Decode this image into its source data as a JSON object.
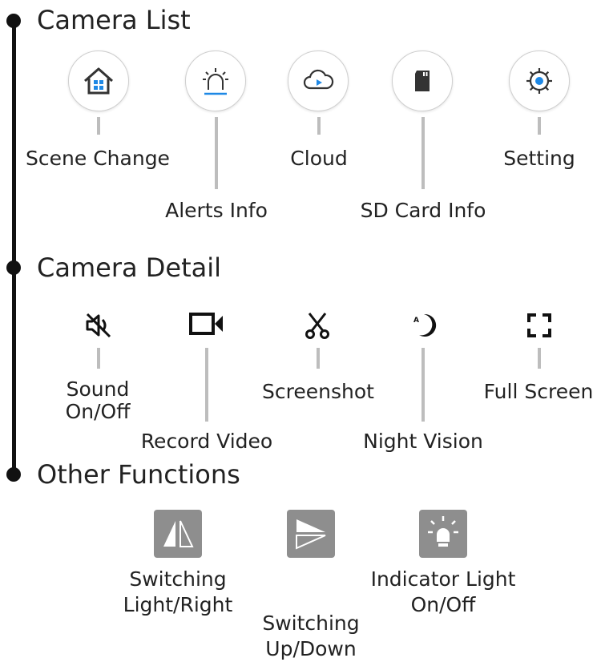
{
  "sections": {
    "camera_list": {
      "title": "Camera List",
      "items": [
        {
          "label": "Scene Change",
          "icon": "house-icon"
        },
        {
          "label": "Alerts Info",
          "icon": "alarm-icon"
        },
        {
          "label": "Cloud",
          "icon": "cloud-icon"
        },
        {
          "label": "SD Card Info",
          "icon": "sd-card-icon"
        },
        {
          "label": "Setting",
          "icon": "gear-icon"
        }
      ]
    },
    "camera_detail": {
      "title": "Camera Detail",
      "items": [
        {
          "label": "Sound\nOn/Off",
          "icon": "mute-icon"
        },
        {
          "label": "Record Video",
          "icon": "video-camera-icon"
        },
        {
          "label": "Screenshot",
          "icon": "scissors-icon"
        },
        {
          "label": "Night Vision",
          "icon": "moon-icon"
        },
        {
          "label": "Full Screen",
          "icon": "fullscreen-icon"
        }
      ]
    },
    "other_functions": {
      "title": "Other Functions",
      "items": [
        {
          "label": "Switching\nLight/Right",
          "icon": "mirror-icon"
        },
        {
          "label": "Switching\nUp/Down",
          "icon": "flip-icon"
        },
        {
          "label": "Indicator Light\nOn/Off",
          "icon": "light-bulb-icon"
        }
      ]
    }
  },
  "colors": {
    "accent_blue": "#1e88e5",
    "icon_dark": "#333333",
    "connector": "#bdbdbd",
    "square_icon": "#8e8e8e"
  }
}
